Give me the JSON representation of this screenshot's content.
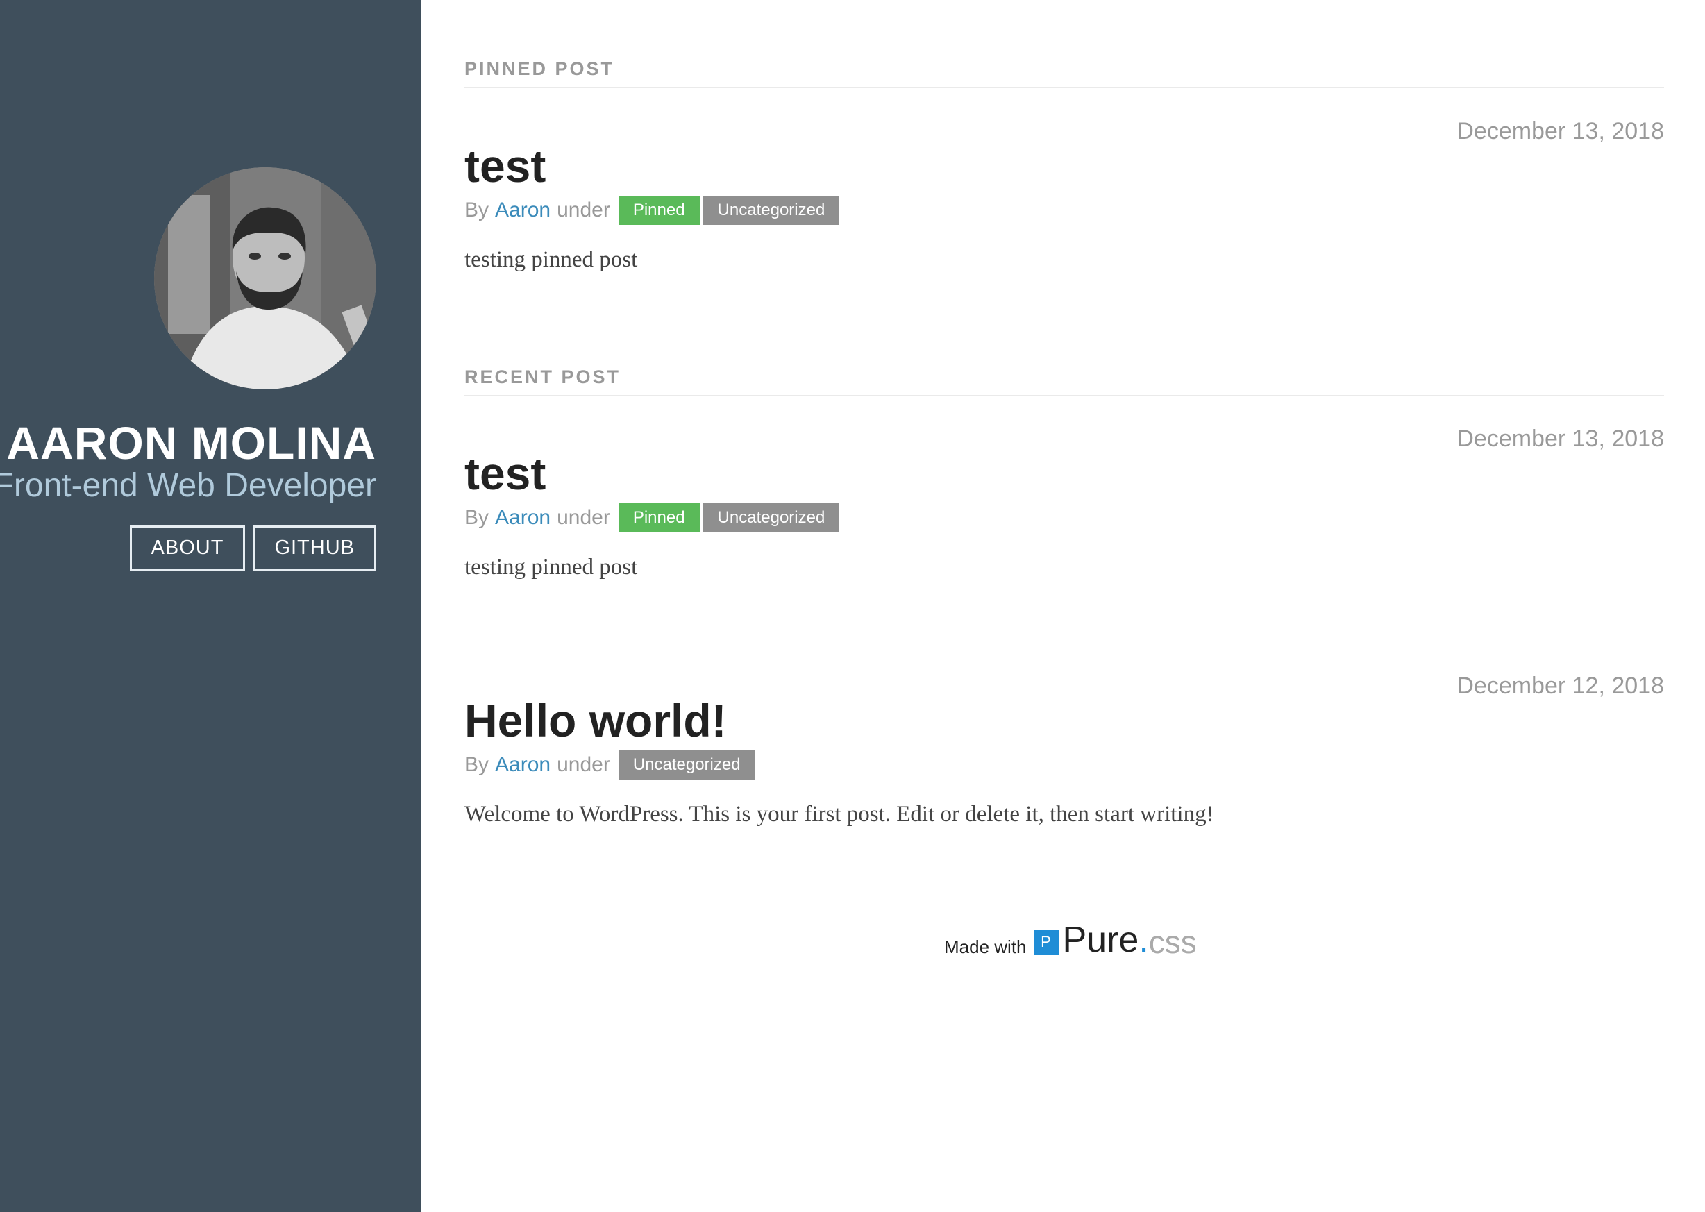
{
  "sidebar": {
    "brand_title": "AARON MOLINA",
    "brand_tagline": "Front-end Web Developer",
    "nav": [
      {
        "label": "ABOUT"
      },
      {
        "label": "GITHUB"
      }
    ],
    "colors": {
      "background": "#3f4f5c",
      "tagline": "#b0cadb"
    }
  },
  "sections": {
    "pinned_heading": "PINNED POST",
    "recent_heading": "RECENT POST"
  },
  "posts": [
    {
      "date": "December 13, 2018",
      "title": "test",
      "by": "By",
      "author": "Aaron",
      "under": "under",
      "categories": [
        "Pinned",
        "Uncategorized"
      ],
      "body": "testing pinned post"
    },
    {
      "date": "December 13, 2018",
      "title": "test",
      "by": "By",
      "author": "Aaron",
      "under": "under",
      "categories": [
        "Pinned",
        "Uncategorized"
      ],
      "body": "testing pinned post"
    },
    {
      "date": "December 12, 2018",
      "title": "Hello world!",
      "by": "By",
      "author": "Aaron",
      "under": "under",
      "categories": [
        "Uncategorized"
      ],
      "body": "Welcome to WordPress. This is your first post. Edit or delete it, then start writing!"
    }
  ],
  "footer": {
    "made_with": "Made with",
    "logo_box": "P",
    "logo_word": "Pure",
    "logo_dot": ".",
    "logo_css": "css"
  },
  "colors": {
    "accent_link": "#3b8bba",
    "category_pinned": "#5aba59",
    "category_uncategorized": "#8f8f8f",
    "pure_blue": "#1f8dd6"
  }
}
